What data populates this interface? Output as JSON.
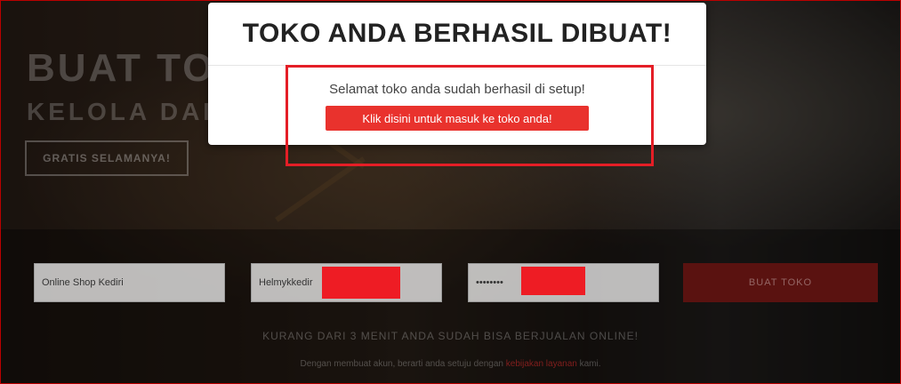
{
  "hero": {
    "title": "BUAT TOKO",
    "subtitle": "KELOLA DARI",
    "free_button": "GRATIS SELAMANYA!"
  },
  "form": {
    "shop_name_value": "Online Shop Kediri",
    "username_value": "Helmykkedir",
    "password_value": "••••••••",
    "submit_label": "BUAT TOKO"
  },
  "tagline": "KURANG DARI 3 MENIT ANDA SUDAH BISA BERJUALAN ONLINE!",
  "terms": {
    "prefix": "Dengan membuat akun, berarti anda setuju dengan",
    "link": "kebijakan layanan",
    "suffix": "kami."
  },
  "modal": {
    "title": "TOKO ANDA BERHASIL DIBUAT!",
    "message": "Selamat toko anda sudah berhasil di setup!",
    "button_label": "Klik disini untuk masuk ke toko anda!"
  },
  "colors": {
    "accent": "#e9322d",
    "annotation": "#e41e26",
    "redaction": "#ee1c24"
  }
}
